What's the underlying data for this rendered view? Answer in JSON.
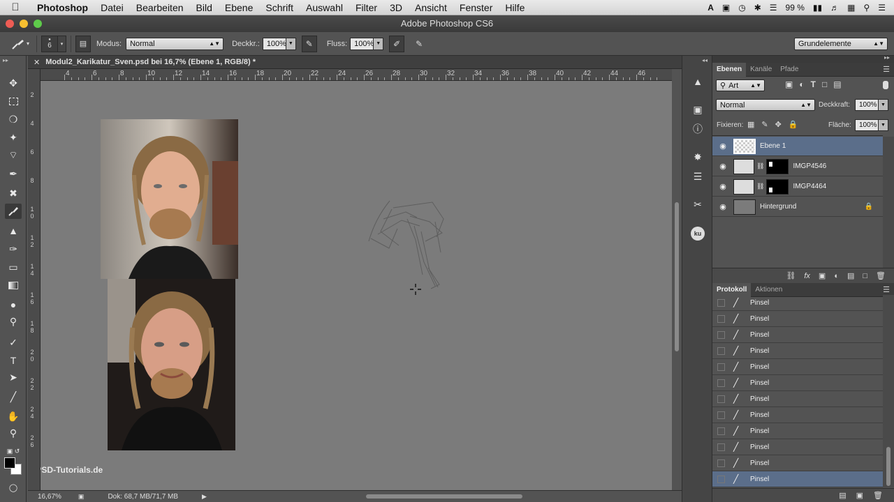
{
  "menubar": {
    "apple": "",
    "app_name": "Photoshop",
    "items": [
      "Datei",
      "Bearbeiten",
      "Bild",
      "Ebene",
      "Schrift",
      "Auswahl",
      "Filter",
      "3D",
      "Ansicht",
      "Fenster",
      "Hilfe"
    ],
    "status": {
      "battery": "99 %"
    }
  },
  "window": {
    "title": "Adobe Photoshop CS6"
  },
  "options": {
    "brush_size": "6",
    "mode_label": "Modus:",
    "mode_value": "Normal",
    "opacity_label": "Deckkr.:",
    "opacity_value": "100%",
    "flow_label": "Fluss:",
    "flow_value": "100%",
    "workspace": "Grundelemente"
  },
  "document": {
    "tab_title": "Modul2_Karikatur_Sven.psd bei 16,7% (Ebene 1, RGB/8) *",
    "ruler_top": [
      "4",
      "6",
      "8",
      "10",
      "12",
      "14",
      "16",
      "18",
      "20",
      "22",
      "24",
      "26",
      "28",
      "30",
      "32",
      "34",
      "36",
      "38",
      "40",
      "42",
      "44",
      "46"
    ],
    "ruler_left": [
      "2",
      "4",
      "6",
      "8",
      "10",
      "12",
      "14",
      "16",
      "18",
      "20",
      "22",
      "24",
      "26"
    ]
  },
  "status": {
    "zoom": "16,67%",
    "doc_info": "Dok: 68,7 MB/71,7 MB"
  },
  "watermark": "PSD-Tutorials.de",
  "layers_panel": {
    "tabs": [
      "Ebenen",
      "Kanäle",
      "Pfade"
    ],
    "filter_kind": "Art",
    "blend_mode": "Normal",
    "opacity_label": "Deckkraft:",
    "opacity_value": "100%",
    "lock_label": "Fixieren:",
    "fill_label": "Fläche:",
    "fill_value": "100%",
    "layers": [
      {
        "name": "Ebene 1",
        "selected": true
      },
      {
        "name": "IMGP4546",
        "selected": false
      },
      {
        "name": "IMGP4464",
        "selected": false
      },
      {
        "name": "Hintergrund",
        "selected": false
      }
    ]
  },
  "history_panel": {
    "tabs": [
      "Protokoll",
      "Aktionen"
    ],
    "items": [
      "Pinsel",
      "Pinsel",
      "Pinsel",
      "Pinsel",
      "Pinsel",
      "Pinsel",
      "Pinsel",
      "Pinsel",
      "Pinsel",
      "Pinsel",
      "Pinsel",
      "Pinsel"
    ]
  },
  "colors": {
    "accent": "#5b6e8a",
    "canvas": "#7b7b7b",
    "panel": "#535353"
  }
}
